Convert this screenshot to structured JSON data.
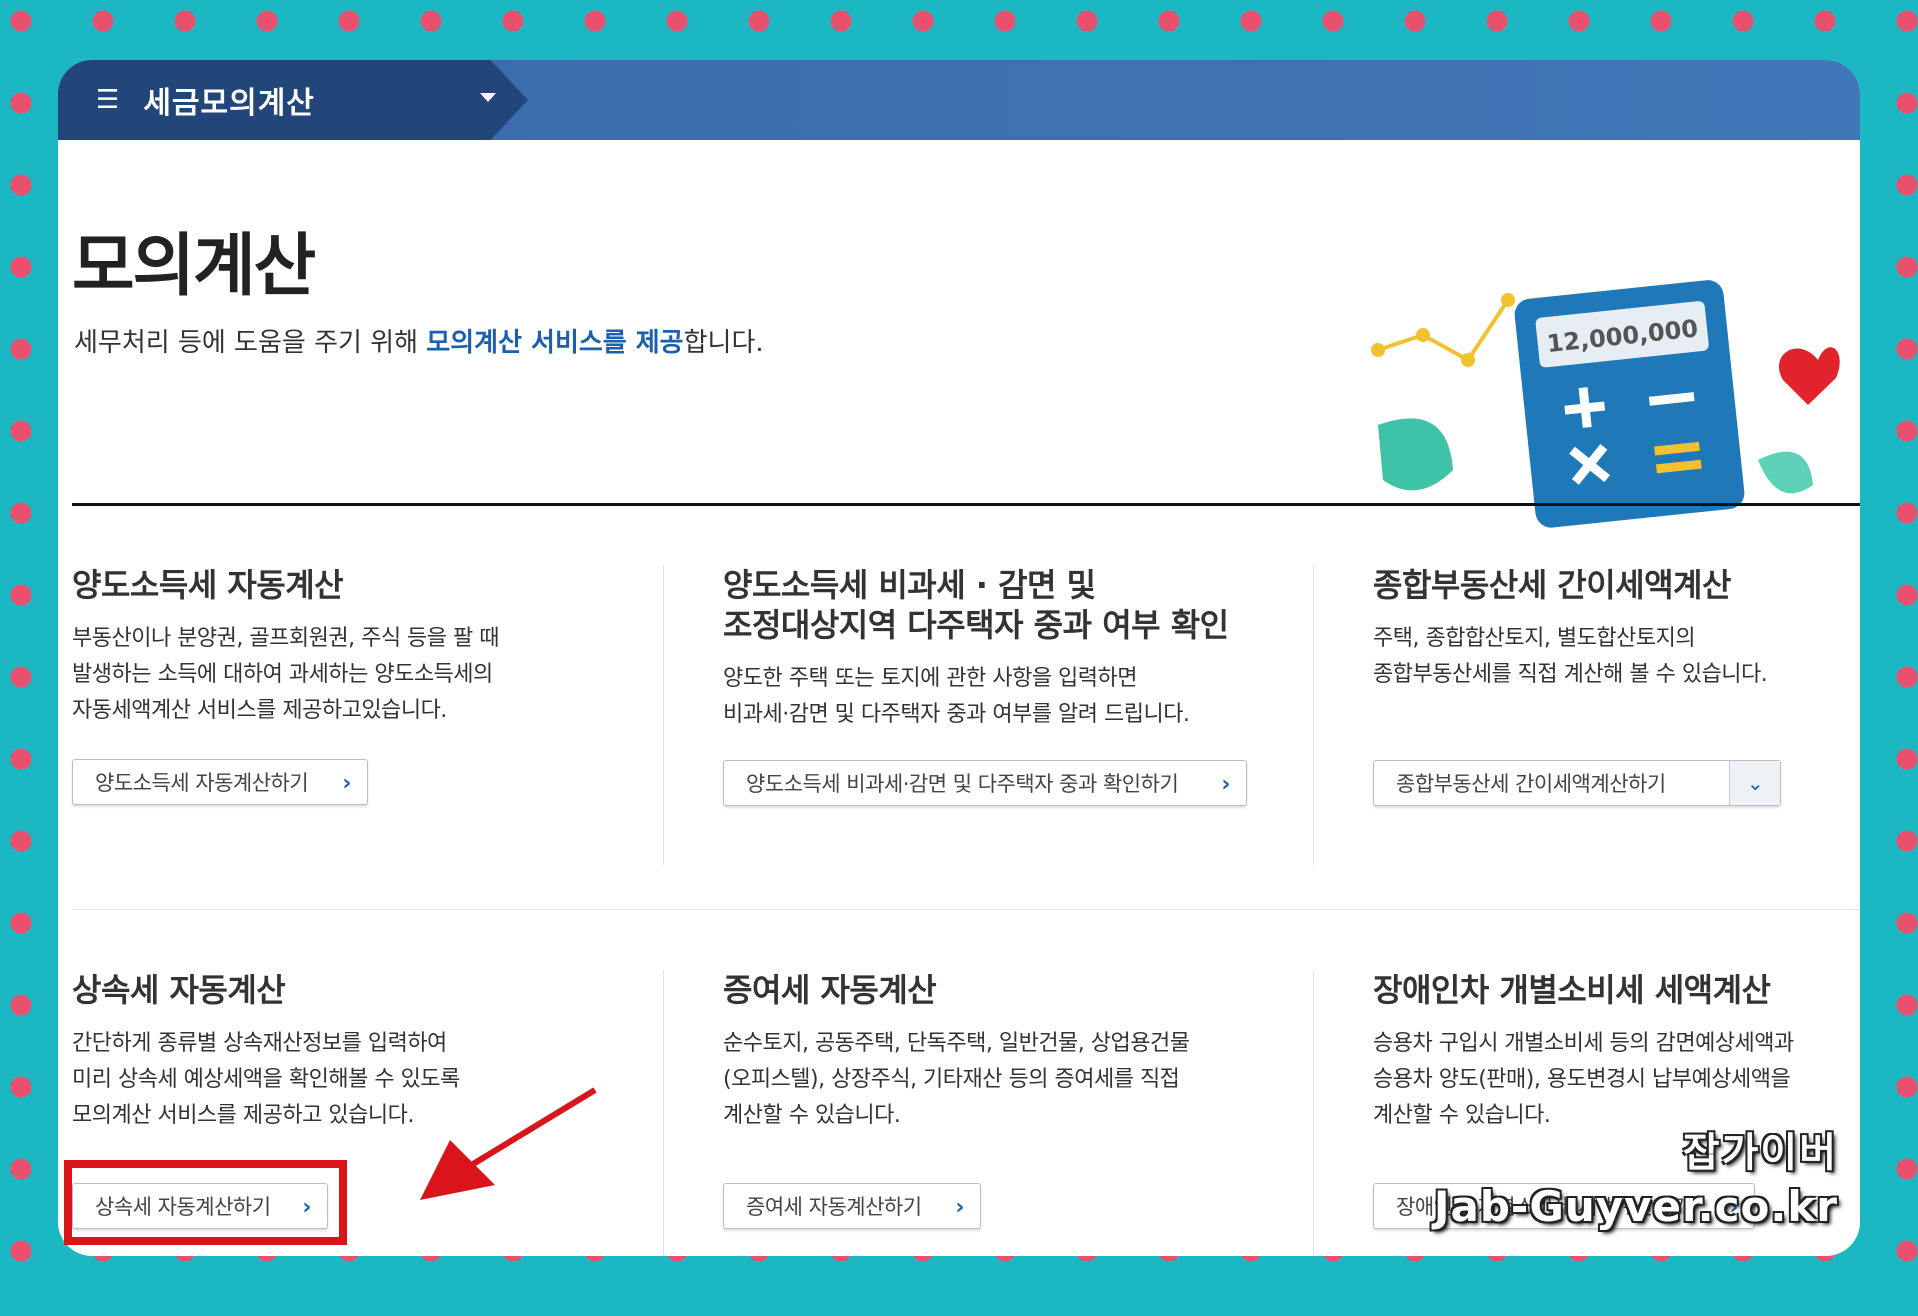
{
  "header": {
    "menu_title": "세금모의계산"
  },
  "intro": {
    "title": "모의계산",
    "desc_before": "세무처리 등에 도움을 주기 위해 ",
    "desc_highlight": "모의계산 서비스를 제공",
    "desc_after": "합니다.",
    "calculator_display": "12,000,000"
  },
  "cards": [
    {
      "title": "양도소득세 자동계산",
      "desc": "부동산이나 분양권, 골프회원권, 주식 등을 팔 때\n발생하는 소득에 대하여 과세하는 양도소득세의\n자동세액계산 서비스를 제공하고있습니다.",
      "button": "양도소득세 자동계산하기"
    },
    {
      "title": "양도소득세 비과세 · 감면 및\n조정대상지역 다주택자 중과 여부 확인",
      "desc": "양도한 주택 또는 토지에 관한 사항을 입력하면\n비과세·감면 및 다주택자 중과 여부를 알려 드립니다.",
      "button": "양도소득세 비과세·감면 및 다주택자 중과 확인하기"
    },
    {
      "title": "종합부동산세 간이세액계산",
      "desc": "주택, 종합합산토지, 별도합산토지의\n종합부동산세를 직접 계산해 볼 수 있습니다.",
      "button": "종합부동산세 간이세액계산하기"
    },
    {
      "title": "상속세 자동계산",
      "desc": "간단하게 종류별 상속재산정보를 입력하여\n미리 상속세 예상세액을 확인해볼 수 있도록\n모의계산 서비스를 제공하고 있습니다.",
      "button": "상속세 자동계산하기"
    },
    {
      "title": "증여세 자동계산",
      "desc": "순수토지, 공동주택, 단독주택, 일반건물, 상업용건물\n(오피스텔), 상장주식, 기타재산 등의 증여세를 직접\n계산할 수 있습니다.",
      "button": "증여세 자동계산하기"
    },
    {
      "title": "장애인차 개별소비세 세액계산",
      "desc": "승용차 구입시 개별소비세 등의 감면예상세액과\n승용차 양도(판매), 용도변경시 납부예상세액을\n계산할 수 있습니다.",
      "button": "장애인차 개별소비세 세액계산하기"
    }
  ],
  "watermark": {
    "line1": "잡가이버",
    "line2": "Jab-Guyver.co.kr"
  },
  "icons": {
    "menu": "hamburger-icon",
    "dropdown": "caret-down-icon",
    "link": "chevron-right-icon",
    "select": "chevron-down-icon"
  },
  "colors": {
    "brand_navy": "#22457a",
    "topbar_blue": "#3f77b8",
    "link_blue": "#1a5fb0",
    "highlight_red": "#d9141b",
    "background_teal": "#1bb8c4",
    "dot_pink": "#e8506e"
  }
}
